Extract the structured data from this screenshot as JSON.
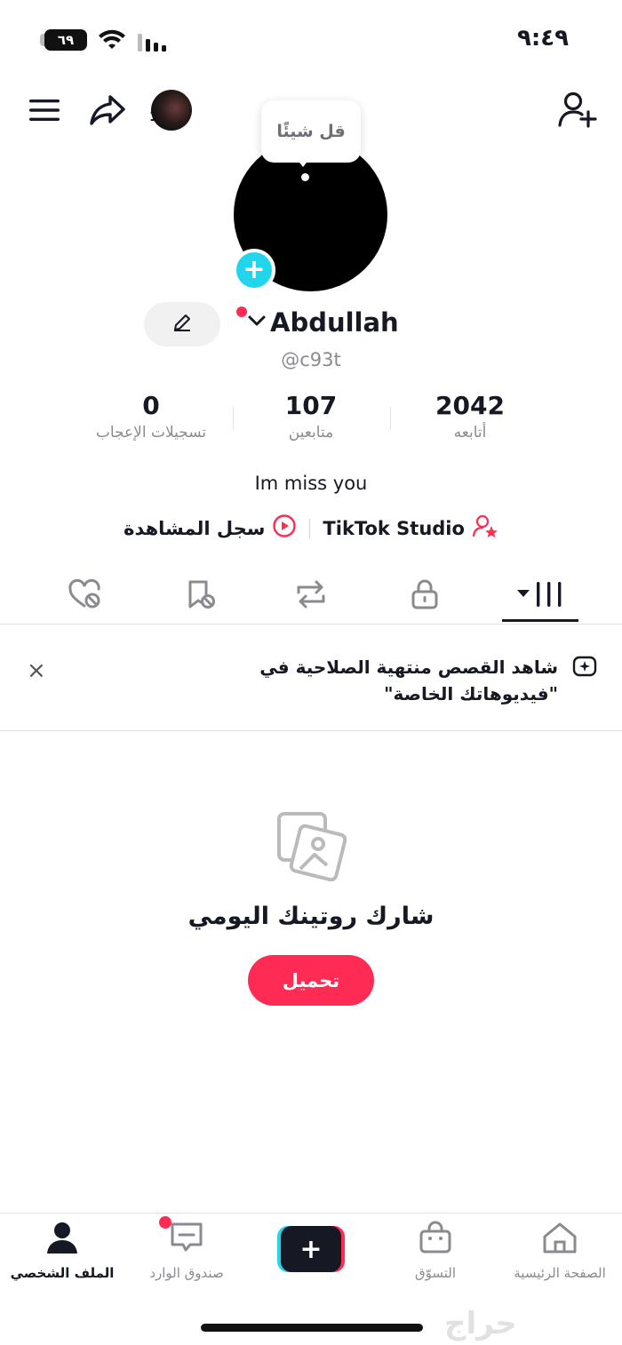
{
  "status_bar": {
    "time": "٩:٤٩",
    "battery": "٦٩"
  },
  "header": {
    "story_count": "1"
  },
  "profile": {
    "note_bubble": "قل شيئًا",
    "name": "Abdullah",
    "username": "@c93t",
    "bio": "Im miss you"
  },
  "stats": [
    {
      "value": "2042",
      "label": "أتابعه"
    },
    {
      "value": "107",
      "label": "متابعين"
    },
    {
      "value": "0",
      "label": "تسجيلات الإعجاب"
    }
  ],
  "links": {
    "studio": "TikTok Studio",
    "history": "سجل المشاهدة"
  },
  "notice": {
    "text": "شاهد القصص منتهية الصلاحية في \"فيديوهاتك الخاصة\"",
    "close": "×"
  },
  "empty_state": {
    "title": "شارك روتينك اليومي",
    "button": "تحميل"
  },
  "bottom_nav": {
    "home": "الصفحة الرئيسية",
    "shop": "التسوّق",
    "create": "+",
    "inbox": "صندوق الوارد",
    "profile": "الملف الشخصي"
  },
  "watermark": "حراج",
  "colors": {
    "accent": "#fe2c55",
    "cyan": "#20d5ec",
    "text": "#161823",
    "muted": "#8a8b91"
  }
}
